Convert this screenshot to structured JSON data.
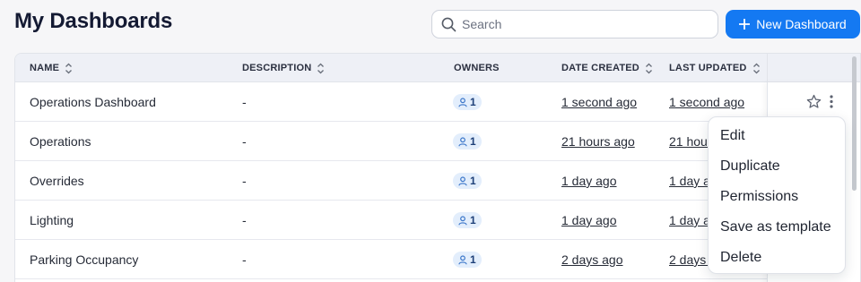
{
  "header": {
    "title": "My Dashboards",
    "search_placeholder": "Search",
    "new_button_label": "New Dashboard"
  },
  "table": {
    "columns": [
      {
        "label": "NAME",
        "sortable": true
      },
      {
        "label": "DESCRIPTION",
        "sortable": true
      },
      {
        "label": "OWNERS",
        "sortable": false
      },
      {
        "label": "DATE CREATED",
        "sortable": true
      },
      {
        "label": "LAST UPDATED",
        "sortable": true
      }
    ],
    "rows": [
      {
        "name": "Operations Dashboard",
        "description": "-",
        "owners": "1",
        "created": "1 second ago",
        "updated": "1 second ago"
      },
      {
        "name": "Operations",
        "description": "-",
        "owners": "1",
        "created": "21 hours ago",
        "updated": "21 hour"
      },
      {
        "name": "Overrides",
        "description": "-",
        "owners": "1",
        "created": "1 day ago",
        "updated": "1 day a"
      },
      {
        "name": "Lighting",
        "description": "-",
        "owners": "1",
        "created": "1 day ago",
        "updated": "1 day a"
      },
      {
        "name": "Parking Occupancy",
        "description": "-",
        "owners": "1",
        "created": "2 days ago",
        "updated": "2 days a"
      }
    ]
  },
  "context_menu": {
    "items": [
      "Edit",
      "Duplicate",
      "Permissions",
      "Save as template",
      "Delete"
    ]
  },
  "colors": {
    "accent": "#1479f2",
    "badge_bg": "#e3eefc",
    "header_bg": "#eef0f6"
  },
  "icons": {
    "search": "search-icon",
    "plus": "plus-icon",
    "sort": "sort-icon",
    "owner": "user-icon",
    "star": "star-icon",
    "more": "more-vertical-icon"
  }
}
